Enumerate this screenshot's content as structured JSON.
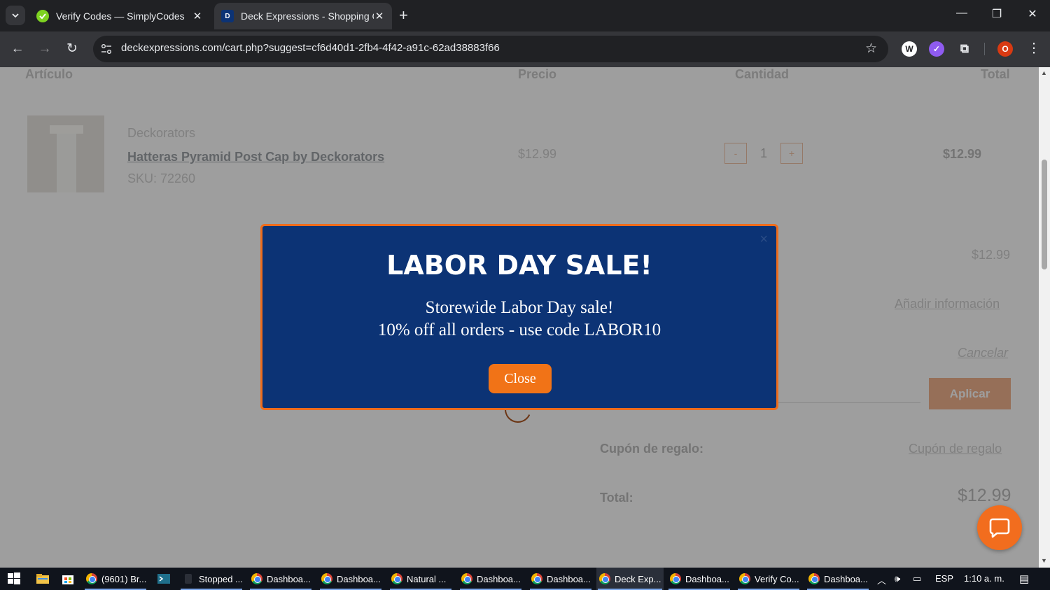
{
  "browser": {
    "tabs": [
      {
        "title": "Verify Codes — SimplyCodes",
        "active": false
      },
      {
        "title": "Deck Expressions - Shopping C",
        "active": true
      }
    ],
    "url": "deckexpressions.com/cart.php?suggest=cf6d40d1-2fb4-4f42-a91c-62ad38883f66",
    "profile_badge": "O"
  },
  "cart": {
    "headers": {
      "item": "Artículo",
      "price": "Precio",
      "qty": "Cantidad",
      "total": "Total"
    },
    "item": {
      "brand": "Deckorators",
      "name": "Hatteras Pyramid Post Cap by Deckorators",
      "sku": "SKU: 72260",
      "price": "$12.99",
      "qty": "1",
      "total": "$12.99",
      "minus": "-",
      "plus": "+"
    },
    "summary": {
      "subtotal": "$12.99",
      "add_info": "Añadir información",
      "cancel": "Cancelar",
      "apply": "Aplicar",
      "gift_label": "Cupón de regalo:",
      "gift_link": "Cupón de regalo",
      "total_label": "Total:",
      "total_value": "$12.99"
    }
  },
  "modal": {
    "title": "LABOR DAY SALE!",
    "line1": "Storewide Labor Day sale!",
    "line2": "10% off all orders - use code LABOR10",
    "close_button": "Close",
    "close_x": "×"
  },
  "taskbar": {
    "apps": [
      {
        "label": "(9601) Br...",
        "active": false
      },
      {
        "label": "Stopped ...",
        "active": false
      },
      {
        "label": "Dashboa...",
        "active": false
      },
      {
        "label": "Dashboa...",
        "active": false
      },
      {
        "label": "Natural ...",
        "active": false
      },
      {
        "label": "Dashboa...",
        "active": false
      },
      {
        "label": "Dashboa...",
        "active": false
      },
      {
        "label": "Deck Exp...",
        "active": true
      },
      {
        "label": "Dashboa...",
        "active": false
      },
      {
        "label": "Verify Co...",
        "active": false
      },
      {
        "label": "Dashboa...",
        "active": false
      }
    ],
    "lang": "ESP",
    "time": "1:10 a. m."
  },
  "colors": {
    "modal_bg": "#0c3375",
    "modal_border": "#ee6c1c",
    "accent_orange": "#f17317"
  }
}
